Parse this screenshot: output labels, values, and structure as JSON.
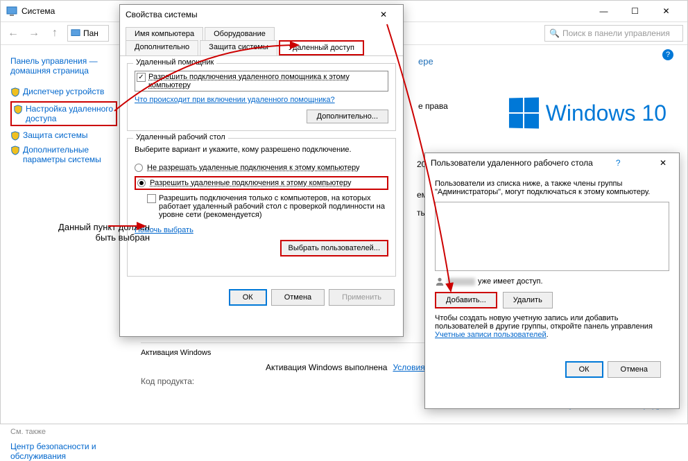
{
  "main_window": {
    "title": "Система",
    "breadcrumb": "Пан",
    "search_placeholder": "Поиск в панели управления"
  },
  "sidebar": {
    "home": "Панель управления — домашняя страница",
    "items": [
      "Диспетчер устройств",
      "Настройка удаленного доступа",
      "Защита системы",
      "Дополнительные параметры системы"
    ],
    "also_label": "См. также",
    "also_item": "Центр безопасности и обслуживания"
  },
  "content": {
    "heading_partial": "ере",
    "rights_partial": "е права",
    "cpu_partial": "20GH",
    "mem_partial": "ема, п",
    "pen_partial": "тья",
    "activation_header": "Активация Windows",
    "activation_status": "Активация Windows выполнена",
    "license_link": "Условия лицензионного соглашения Майкрософт",
    "product_code_label": "Код продукта:",
    "change_key": "Изменить ключ продукта",
    "win10_brand": "Windows 10"
  },
  "dialog1": {
    "title": "Свойства системы",
    "tabs_row1": [
      "Имя компьютера",
      "Оборудование"
    ],
    "tabs_row2": [
      "Дополнительно",
      "Защита системы",
      "Удаленный доступ"
    ],
    "group1": {
      "title": "Удаленный помощник",
      "checkbox": "Разрешить подключения удаленного помощника к этому компьютеру",
      "link": "Что происходит при включении удаленного помощника?",
      "btn": "Дополнительно..."
    },
    "group2": {
      "title": "Удаленный рабочий стол",
      "desc": "Выберите вариант и укажите, кому разрешено подключение.",
      "radio1": "Не разрешать удаленные подключения к этому компьютеру",
      "radio2": "Разрешить удаленные подключения к этому компьютеру",
      "checkbox": "Разрешить подключения только с компьютеров, на которых работает удаленный рабочий стол с проверкой подлинности на уровне сети (рекомендуется)",
      "help_link": "Помочь выбрать",
      "select_users_btn": "Выбрать пользователей..."
    },
    "buttons": {
      "ok": "ОК",
      "cancel": "Отмена",
      "apply": "Применить"
    }
  },
  "dialog2": {
    "title": "Пользователи удаленного рабочего стола",
    "desc": "Пользователи из списка ниже, а также члены группы \"Администраторы\", могут подключаться к этому компьютеру.",
    "access_text": "уже имеет доступ.",
    "btn_add": "Добавить...",
    "btn_del": "Удалить",
    "footer_text": "Чтобы создать новую учетную запись или добавить пользователей в другие группы, откройте панель управления ",
    "footer_link": "Учетные записи пользователей",
    "ok": "ОК",
    "cancel": "Отмена"
  },
  "annotation": "Данный пункт должен быть выбран"
}
